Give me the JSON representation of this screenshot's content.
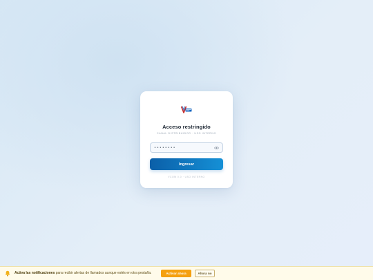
{
  "login": {
    "title": "Acceso restringido",
    "subtitle": "CANAL DISTRIBUIDOR · USO INTERNO",
    "password_value": "••••••••",
    "submit_label": "Ingresar",
    "footer": "VCOM 0.0 · USO INTERNO"
  },
  "notification": {
    "bold_text": "Activa las notificaciones",
    "text": "para recibir alertas de llamados aunque estés en otra pestaña.",
    "activate_label": "Activar ahora",
    "later_label": "Ahora no"
  },
  "icons": {
    "logo": "vcom-logo",
    "password_toggle": "eye-icon",
    "notification": "bell-icon"
  },
  "colors": {
    "primary_start": "#0b5fa8",
    "primary_end": "#1590d6",
    "notification_accent": "#f5a00f"
  }
}
